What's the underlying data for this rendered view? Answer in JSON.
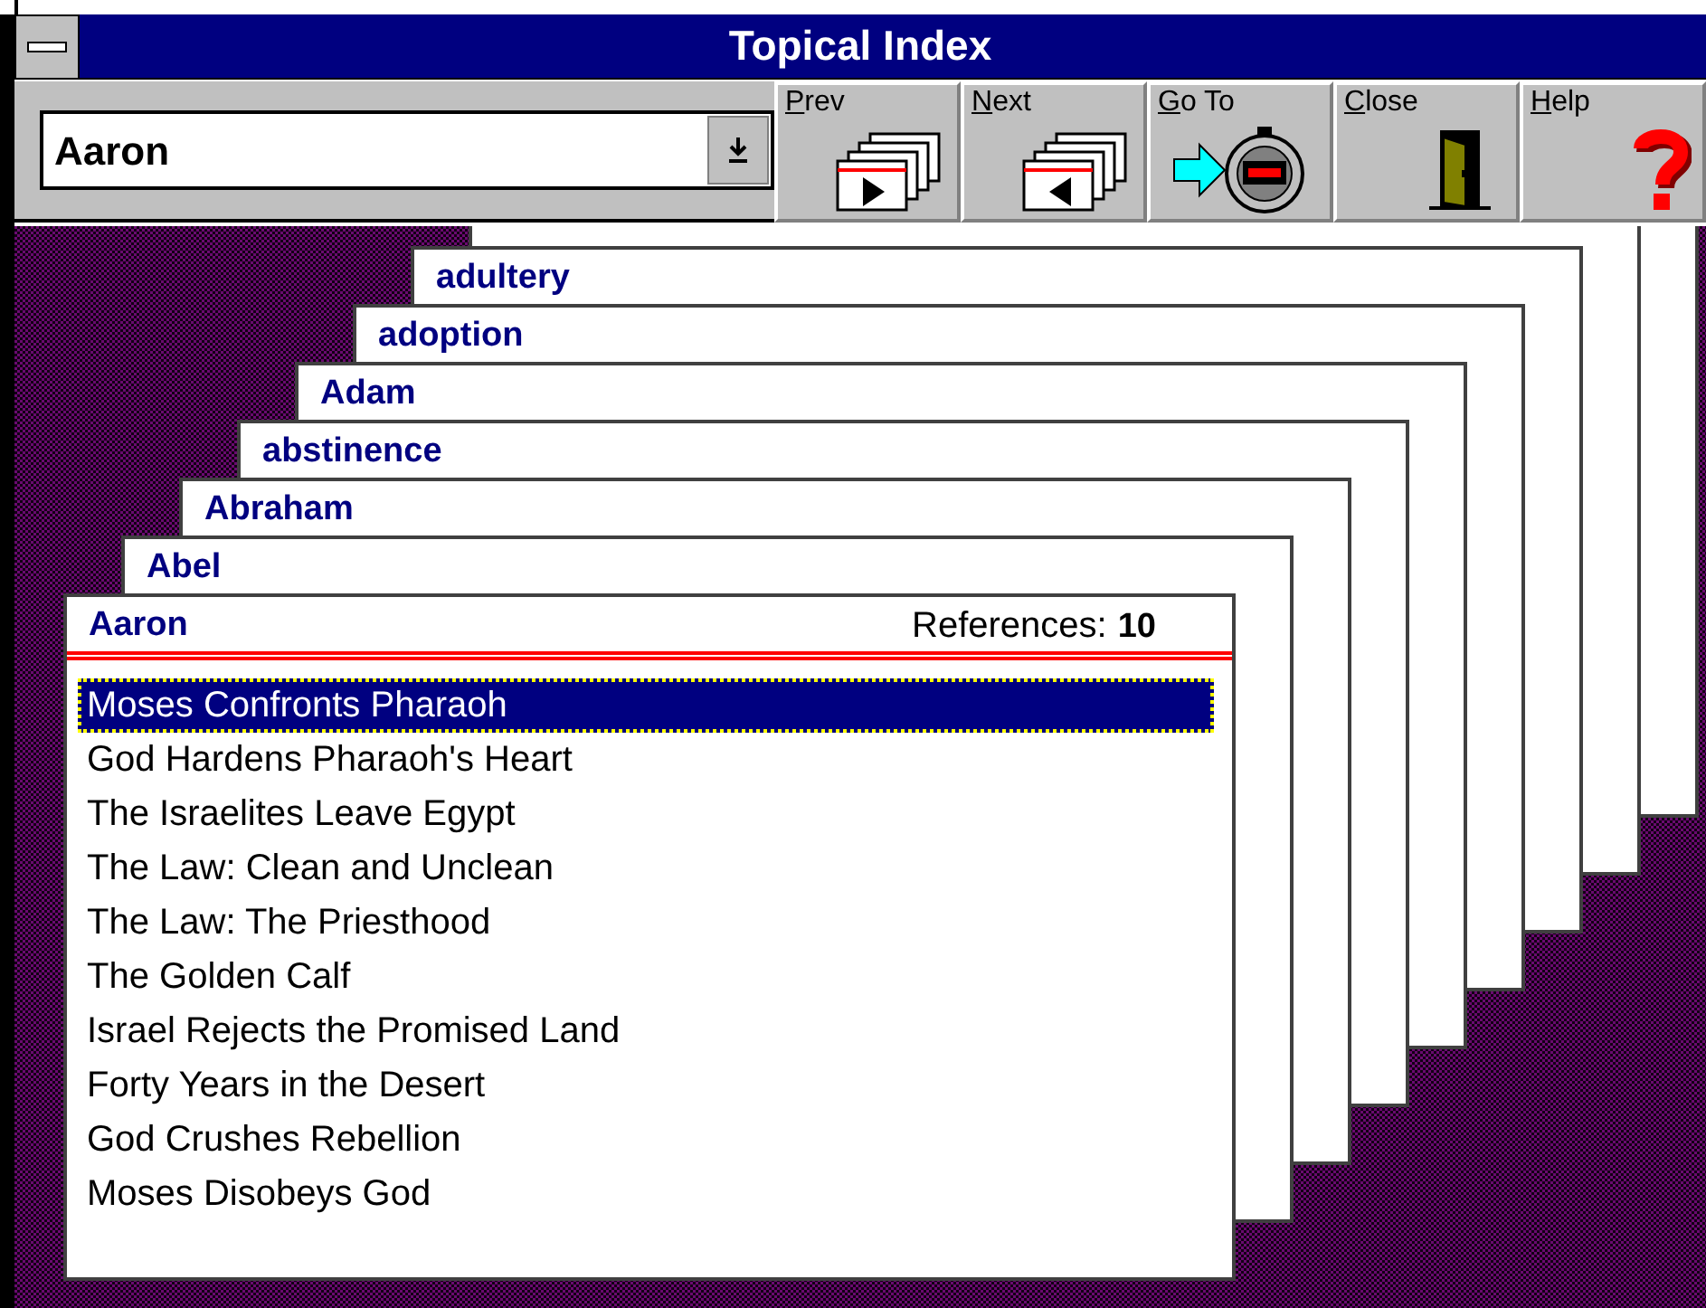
{
  "window": {
    "title": "Topical Index"
  },
  "topic_field": {
    "value": "Aaron"
  },
  "toolbar": [
    {
      "label": "Prev",
      "kind": "prev"
    },
    {
      "label": "Next",
      "kind": "next"
    },
    {
      "label": "Go To",
      "kind": "goto"
    },
    {
      "label": "Close",
      "kind": "close"
    },
    {
      "label": "Help",
      "kind": "help"
    }
  ],
  "cards": [
    {
      "label": "adultery"
    },
    {
      "label": "adoption"
    },
    {
      "label": "Adam"
    },
    {
      "label": "abstinence"
    },
    {
      "label": "Abraham"
    },
    {
      "label": "Abel"
    }
  ],
  "front_card": {
    "topic": "Aaron",
    "references_label": "References:",
    "references_count": "10",
    "items": [
      {
        "text": "Moses Confronts Pharaoh",
        "selected": true
      },
      {
        "text": "God Hardens Pharaoh's Heart",
        "selected": false
      },
      {
        "text": "The Israelites Leave Egypt",
        "selected": false
      },
      {
        "text": "The Law: Clean and Unclean",
        "selected": false
      },
      {
        "text": "The Law: The Priesthood",
        "selected": false
      },
      {
        "text": "The Golden Calf",
        "selected": false
      },
      {
        "text": "Israel Rejects the Promised Land",
        "selected": false
      },
      {
        "text": "Forty Years in the Desert",
        "selected": false
      },
      {
        "text": "God Crushes Rebellion",
        "selected": false
      },
      {
        "text": "Moses Disobeys God",
        "selected": false
      }
    ]
  }
}
